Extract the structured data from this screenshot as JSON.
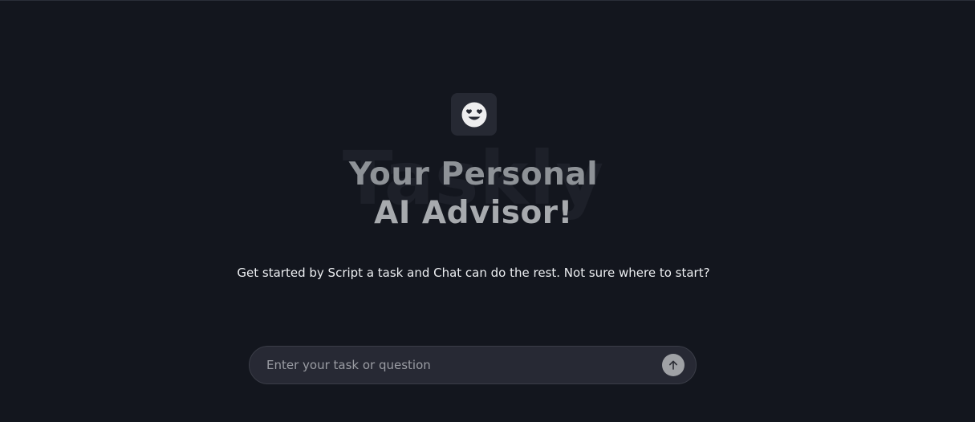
{
  "brand": {
    "watermark": "Taskly"
  },
  "hero": {
    "title_line1": "Your Personal",
    "title_line2": "AI Advisor!",
    "subtitle": "Get started by Script a task and Chat can do the rest. Not sure where to start?"
  },
  "composer": {
    "placeholder": "Enter your task or question",
    "value": ""
  },
  "icons": {
    "logo": "heart-eyes-smiley-icon",
    "send": "arrow-up-icon"
  },
  "colors": {
    "background": "#13161e",
    "logo_box": "#262933",
    "input_background": "#272934",
    "send_button": "#9fa1a5"
  }
}
